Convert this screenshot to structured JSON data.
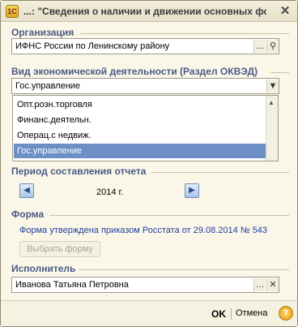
{
  "window": {
    "title": "...: \"Сведения о наличии и движении основных фо..."
  },
  "organization": {
    "label": "Организация",
    "value": "ИФНС России по Ленинскому району"
  },
  "activity": {
    "label": "Вид экономической деятельности (Раздел ОКВЭД)",
    "value": "Гос.управление",
    "options": [
      "Опт.розн.торговля",
      "Финанс.деятельн.",
      "Операц.с недвиж.",
      "Гос.управление"
    ],
    "selected_index": 3
  },
  "period": {
    "label": "Период составления отчета",
    "year": "2014 г."
  },
  "form": {
    "label": "Форма",
    "link_text": "Форма утверждена приказом Росстата от 29.08.2014 № 543",
    "choose_button": "Выбрать форму"
  },
  "executor": {
    "label": "Исполнитель",
    "value": "Иванова Татьяна Петровна"
  },
  "buttons": {
    "ok": "OK",
    "cancel": "Отмена",
    "help": "?"
  },
  "icons": {
    "app": "1c-app-icon",
    "close": "close-icon",
    "ellipsis": "ellipsis-icon",
    "search": "search-icon",
    "clear": "clear-icon",
    "dropdown": "chevron-down-icon",
    "prev": "arrow-left-icon",
    "next": "arrow-right-icon"
  }
}
